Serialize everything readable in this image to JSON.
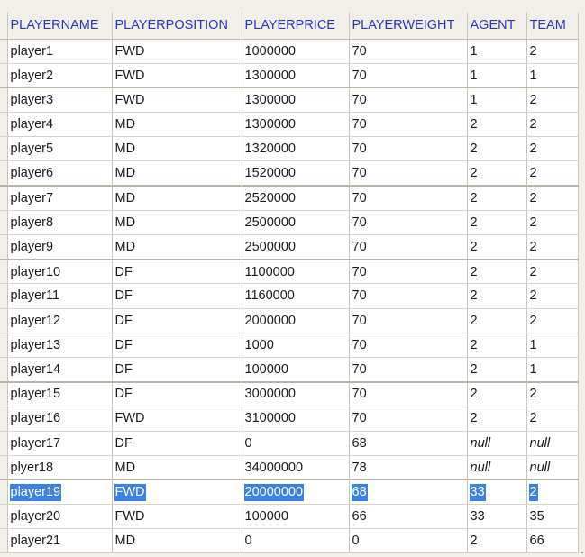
{
  "table": {
    "columns": [
      "PLAYERNAME",
      "PLAYERPOSITION",
      "PLAYERPRICE",
      "PLAYERWEIGHT",
      "AGENT",
      "TEAM"
    ],
    "rows": [
      {
        "name": "player1",
        "position": "FWD",
        "price": "1000000",
        "weight": "70",
        "agent": "1",
        "team": "2"
      },
      {
        "name": "player2",
        "position": "FWD",
        "price": "1300000",
        "weight": "70",
        "agent": "1",
        "team": "1"
      },
      {
        "name": "player3",
        "position": "FWD",
        "price": "1300000",
        "weight": "70",
        "agent": "1",
        "team": "2"
      },
      {
        "name": "player4",
        "position": "MD",
        "price": "1300000",
        "weight": "70",
        "agent": "2",
        "team": "2"
      },
      {
        "name": "player5",
        "position": "MD",
        "price": "1320000",
        "weight": "70",
        "agent": "2",
        "team": "2"
      },
      {
        "name": "player6",
        "position": "MD",
        "price": "1520000",
        "weight": "70",
        "agent": "2",
        "team": "2"
      },
      {
        "name": "player7",
        "position": "MD",
        "price": "2520000",
        "weight": "70",
        "agent": "2",
        "team": "2"
      },
      {
        "name": "player8",
        "position": "MD",
        "price": "2500000",
        "weight": "70",
        "agent": "2",
        "team": "2"
      },
      {
        "name": "player9",
        "position": "MD",
        "price": "2500000",
        "weight": "70",
        "agent": "2",
        "team": "2"
      },
      {
        "name": "player10",
        "position": "DF",
        "price": "1100000",
        "weight": "70",
        "agent": "2",
        "team": "2"
      },
      {
        "name": "player11",
        "position": "DF",
        "price": "1160000",
        "weight": "70",
        "agent": "2",
        "team": "2"
      },
      {
        "name": "player12",
        "position": "DF",
        "price": "2000000",
        "weight": "70",
        "agent": "2",
        "team": "2"
      },
      {
        "name": "player13",
        "position": "DF",
        "price": "1000",
        "weight": "70",
        "agent": "2",
        "team": "1"
      },
      {
        "name": "player14",
        "position": "DF",
        "price": "100000",
        "weight": "70",
        "agent": "2",
        "team": "1"
      },
      {
        "name": "player15",
        "position": "DF",
        "price": "3000000",
        "weight": "70",
        "agent": "2",
        "team": "2"
      },
      {
        "name": "player16",
        "position": "FWD",
        "price": "3100000",
        "weight": "70",
        "agent": "2",
        "team": "2"
      },
      {
        "name": "player17",
        "position": "DF",
        "price": "0",
        "weight": "68",
        "agent": "null",
        "team": "null"
      },
      {
        "name": "plyer18",
        "position": "MD",
        "price": "34000000",
        "weight": "78",
        "agent": "null",
        "team": "null"
      },
      {
        "name": "player19",
        "position": "FWD",
        "price": "20000000",
        "weight": "68",
        "agent": "33",
        "team": "2"
      },
      {
        "name": "player20",
        "position": "FWD",
        "price": "100000",
        "weight": "66",
        "agent": "33",
        "team": "35"
      },
      {
        "name": "player21",
        "position": "MD",
        "price": "0",
        "weight": "0",
        "agent": "2",
        "team": "66"
      }
    ]
  }
}
